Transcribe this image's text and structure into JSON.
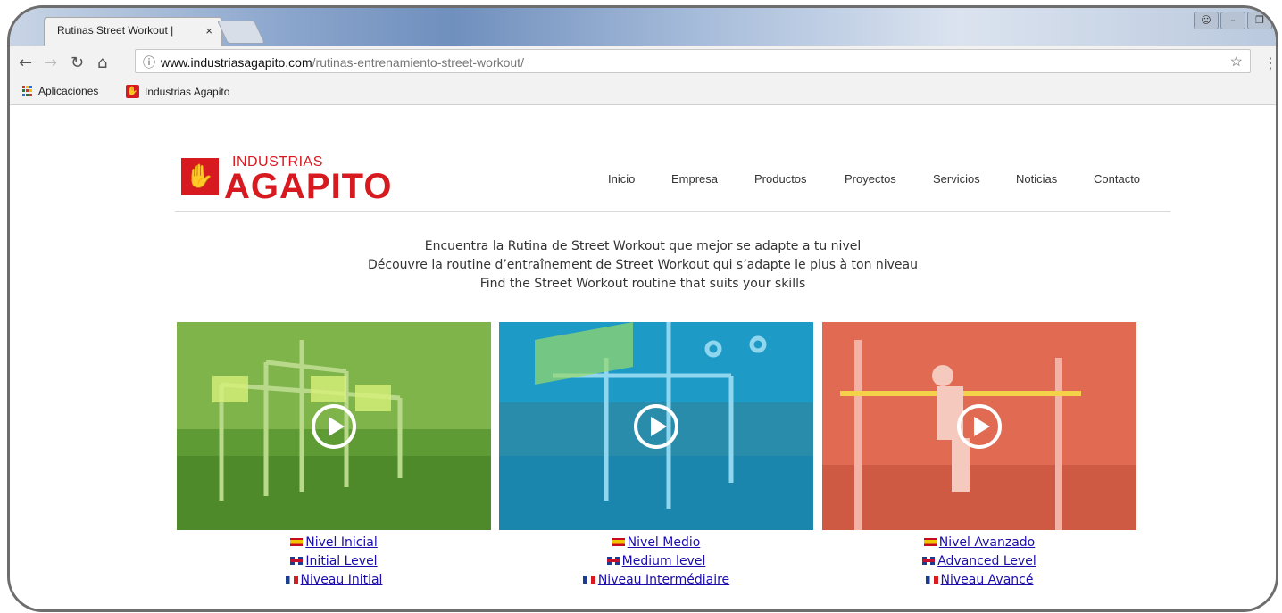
{
  "browser": {
    "tab_title": "Rutinas Street Workout |",
    "tab_close": "×",
    "url_host": "www.industriasagapito.com",
    "url_path": "/rutinas-entrenamiento-street-workout/",
    "bookmarks": [
      {
        "label": "Aplicaciones"
      },
      {
        "label": "Industrias Agapito"
      }
    ]
  },
  "site": {
    "logo_top": "INDUSTRIAS",
    "logo_bottom": "AGAPITO",
    "nav": [
      "Inicio",
      "Empresa",
      "Productos",
      "Proyectos",
      "Servicios",
      "Noticias",
      "Contacto"
    ]
  },
  "intro": [
    "Encuentra la Rutina de Street Workout que mejor se adapte a tu nivel",
    "Découvre la routine d’entraînement de Street Workout qui s’adapte le plus à ton niveau",
    "Find the Street Workout routine that suits your skills"
  ],
  "levels": [
    {
      "color": "#5a9a2e",
      "es": "Nivel Inicial",
      "en": "Initial Level",
      "fr": "Niveau Initial"
    },
    {
      "color": "#1d9bc6",
      "es": "Nivel Medio",
      "en": "Medium level",
      "fr": "Niveau Intermédiaire"
    },
    {
      "color": "#e06a52",
      "es": "Nivel Avanzado",
      "en": "Advanced Level",
      "fr": "Niveau Avancé"
    }
  ],
  "colors": {
    "brand_red": "#d71920",
    "link": "#1a0dab"
  }
}
